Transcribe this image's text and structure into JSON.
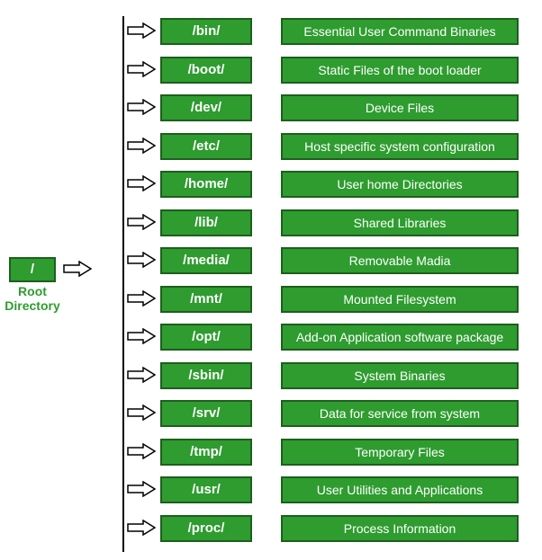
{
  "root": {
    "symbol": "/",
    "label": "Root\nDirectory"
  },
  "rows": [
    {
      "dir": "/bin/",
      "desc": "Essential User Command Binaries"
    },
    {
      "dir": "/boot/",
      "desc": "Static Files of the boot loader"
    },
    {
      "dir": "/dev/",
      "desc": "Device Files"
    },
    {
      "dir": "/etc/",
      "desc": "Host specific system configuration"
    },
    {
      "dir": "/home/",
      "desc": "User home Directories"
    },
    {
      "dir": "/lib/",
      "desc": "Shared Libraries"
    },
    {
      "dir": "/media/",
      "desc": "Removable Madia"
    },
    {
      "dir": "/mnt/",
      "desc": "Mounted Filesystem"
    },
    {
      "dir": "/opt/",
      "desc": "Add-on Application software package"
    },
    {
      "dir": "/sbin/",
      "desc": "System Binaries"
    },
    {
      "dir": "/srv/",
      "desc": "Data for service from system"
    },
    {
      "dir": "/tmp/",
      "desc": "Temporary Files"
    },
    {
      "dir": "/usr/",
      "desc": "User Utilities and Applications"
    },
    {
      "dir": "/proc/",
      "desc": "Process Information"
    }
  ],
  "colors": {
    "box_fill": "#2e9c2f",
    "box_border": "#1d5f1d",
    "text_on_box": "#ffffff",
    "root_label": "#2e9c2f"
  }
}
